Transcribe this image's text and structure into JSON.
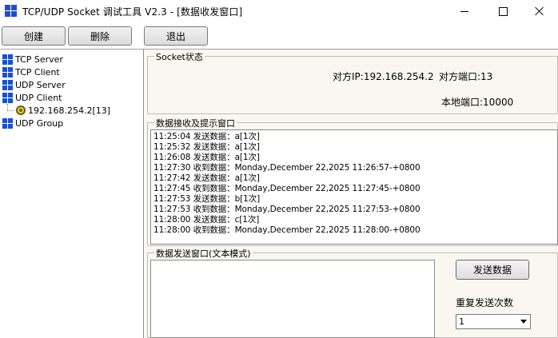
{
  "window": {
    "title": "TCP/UDP Socket 调试工具 V2.3 - [数据收发窗口]"
  },
  "toolbar": {
    "create_label": "创建",
    "delete_label": "删除",
    "exit_label": "退出"
  },
  "tree": {
    "items": [
      {
        "label": "TCP Server"
      },
      {
        "label": "TCP Client"
      },
      {
        "label": "UDP Server"
      },
      {
        "label": "UDP Client"
      },
      {
        "label": "192.168.254.2[13]"
      },
      {
        "label": "UDP Group"
      }
    ]
  },
  "socket_status": {
    "legend": "Socket状态",
    "peer_ip": "对方IP:192.168.254.2",
    "peer_port": "对方端口:13",
    "local_port": "本地端口:10000"
  },
  "receive": {
    "legend": "数据接收及提示窗口",
    "lines": [
      "11:25:04 发送数据：a[1次]",
      "11:25:32 发送数据：a[1次]",
      "11:26:08 发送数据：a[1次]",
      "11:27:30 收到数据：Monday,December 22,2025 11:26:57-+0800",
      "11:27:42 发送数据：a[1次]",
      "11:27:45 收到数据：Monday,December 22,2025 11:27:45-+0800",
      "11:27:53 发送数据：b[1次]",
      "11:27:53 收到数据：Monday,December 22,2025 11:27:53-+0800",
      "11:28:00 发送数据：c[1次]",
      "11:28:00 收到数据：Monday,December 22,2025 11:28:00-+0800"
    ]
  },
  "send": {
    "legend": "数据发送窗口(文本模式)",
    "send_button_label": "发送数据",
    "repeat_label": "重复发送次数",
    "repeat_value": "1",
    "input_value": ""
  },
  "icons": {
    "app": "app-grid-icon",
    "tree_node": "grid-icon",
    "connection": "connection-node-icon"
  },
  "colors": {
    "icon_blue": "#1a4fd6",
    "panel_bg": "#f9f7f0"
  }
}
